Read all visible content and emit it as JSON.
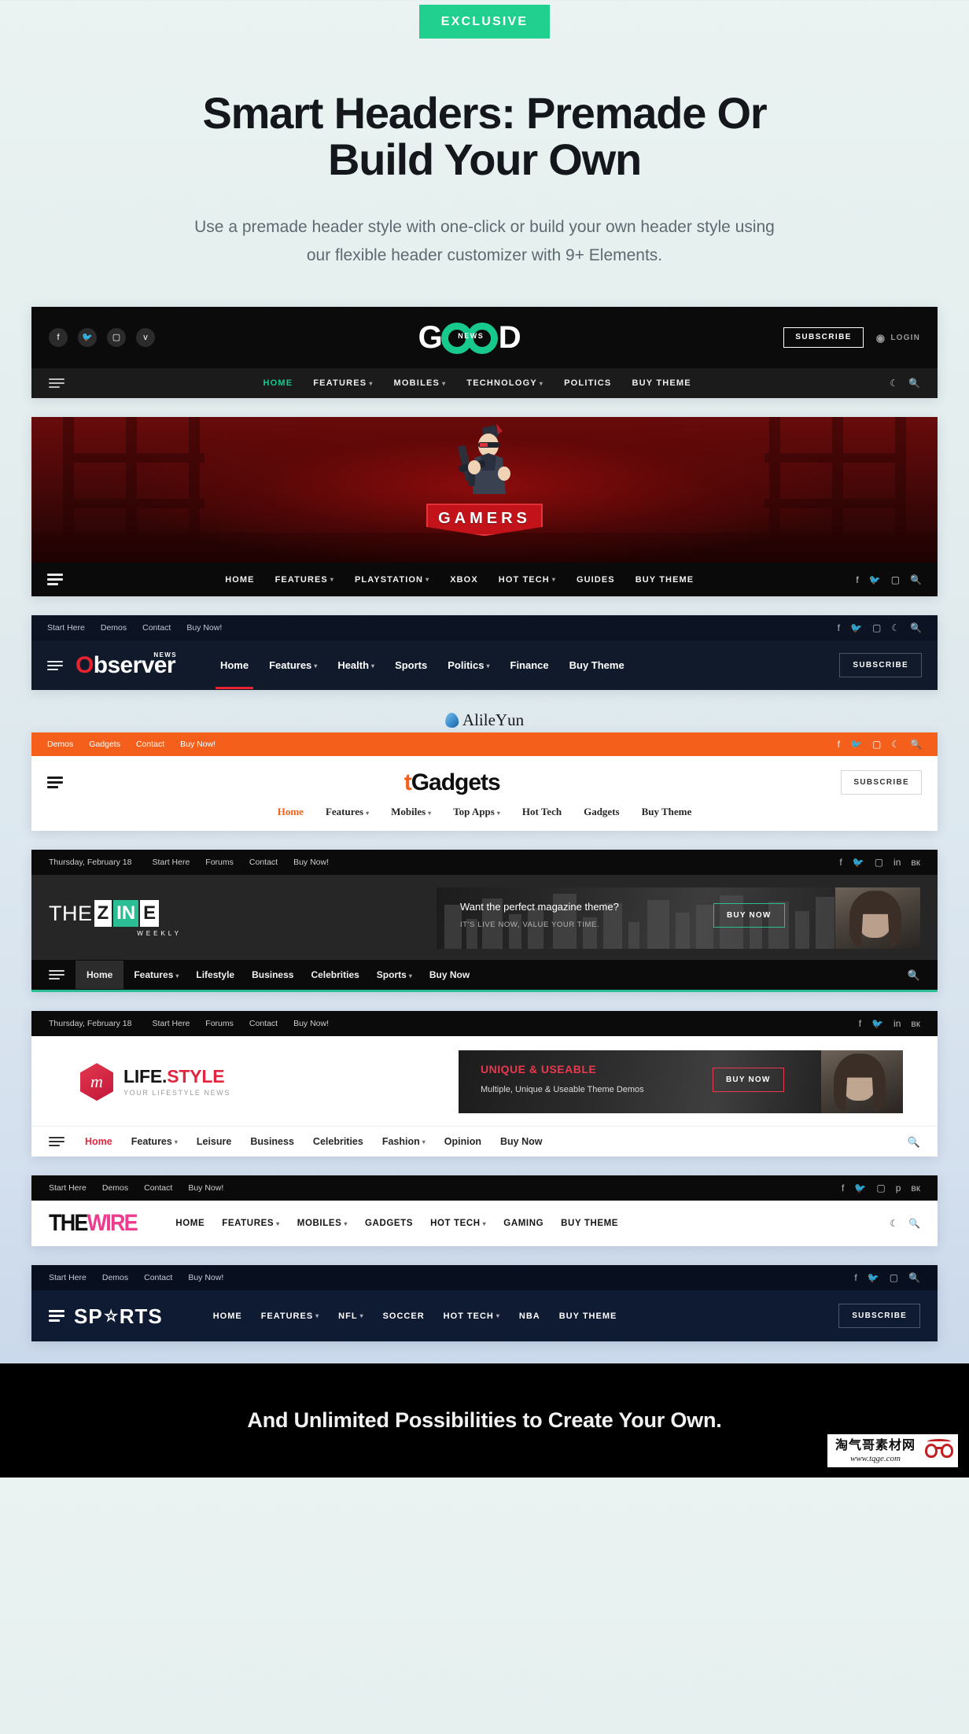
{
  "hero": {
    "badge": "EXCLUSIVE",
    "title_line1": "Smart Headers: Premade Or",
    "title_line2": "Build Your Own",
    "subtitle": "Use a premade header style with one-click or build your own header style using our flexible header customizer with 9+ Elements.",
    "accent_color": "#21d08f"
  },
  "headers": {
    "good": {
      "name": "GOOD NEWS",
      "logo_g": "G",
      "logo_d": "D",
      "logo_badge": "NEWS",
      "social": [
        "facebook-icon",
        "twitter-icon",
        "instagram-icon",
        "vimeo-icon"
      ],
      "subscribe": "SUBSCRIBE",
      "login": "LOGIN",
      "nav": [
        {
          "label": "HOME",
          "active": true,
          "caret": false
        },
        {
          "label": "FEATURES",
          "active": false,
          "caret": true
        },
        {
          "label": "MOBILES",
          "active": false,
          "caret": true
        },
        {
          "label": "TECHNOLOGY",
          "active": false,
          "caret": true
        },
        {
          "label": "POLITICS",
          "active": false,
          "caret": false
        },
        {
          "label": "BUY THEME",
          "active": false,
          "caret": false
        }
      ],
      "accent": "#17c98c"
    },
    "gamers": {
      "name": "GAMERS",
      "logo_text": "GAMERS",
      "nav": [
        {
          "label": "HOME",
          "caret": false
        },
        {
          "label": "FEATURES",
          "caret": true
        },
        {
          "label": "PLAYSTATION",
          "caret": true
        },
        {
          "label": "XBOX",
          "caret": false
        },
        {
          "label": "HOT TECH",
          "caret": true
        },
        {
          "label": "GUIDES",
          "caret": false
        },
        {
          "label": "BUY THEME",
          "caret": false
        }
      ],
      "social": [
        "facebook-icon",
        "twitter-icon",
        "instagram-icon"
      ],
      "accent": "#c2131a"
    },
    "observer": {
      "name": "Observer",
      "logo_o": "O",
      "logo_rest": "bserver",
      "logo_sup": "NEWS",
      "topbar": [
        "Start Here",
        "Demos",
        "Contact",
        "Buy Now!"
      ],
      "social": [
        "facebook-icon",
        "twitter-icon",
        "instagram-icon",
        "moon-icon",
        "search-icon"
      ],
      "subscribe": "SUBSCRIBE",
      "nav": [
        {
          "label": "Home",
          "active": true,
          "caret": false
        },
        {
          "label": "Features",
          "active": false,
          "caret": true
        },
        {
          "label": "Health",
          "active": false,
          "caret": true
        },
        {
          "label": "Sports",
          "active": false,
          "caret": false
        },
        {
          "label": "Politics",
          "active": false,
          "caret": true
        },
        {
          "label": "Finance",
          "active": false,
          "caret": false
        },
        {
          "label": "Buy Theme",
          "active": false,
          "caret": false
        }
      ],
      "accent": "#e8232f"
    },
    "watermark_top": {
      "text_a": "Alile",
      "text_y": "Y",
      "text_b": "un"
    },
    "gadgets": {
      "name": "Gadgets",
      "logo_t": "t",
      "logo_rest": "Gadgets",
      "topbar": [
        "Demos",
        "Gadgets",
        "Contact",
        "Buy Now!"
      ],
      "social": [
        "facebook-icon",
        "twitter-icon",
        "instagram-icon",
        "moon-icon",
        "search-icon"
      ],
      "subscribe": "SUBSCRIBE",
      "nav": [
        {
          "label": "Home",
          "active": true,
          "caret": false
        },
        {
          "label": "Features",
          "active": false,
          "caret": true
        },
        {
          "label": "Mobiles",
          "active": false,
          "caret": true
        },
        {
          "label": "Top Apps",
          "active": false,
          "caret": true
        },
        {
          "label": "Hot Tech",
          "active": false,
          "caret": false
        },
        {
          "label": "Gadgets",
          "active": false,
          "caret": false
        },
        {
          "label": "Buy Theme",
          "active": false,
          "caret": false
        }
      ],
      "accent": "#f4601c"
    },
    "zine": {
      "name": "THE ZINE WEEKLY",
      "logo_the": "THE",
      "logo_z": "Z",
      "logo_in": "IN",
      "logo_e": "E",
      "logo_weekly": "WEEKLY",
      "date": "Thursday, February 18",
      "topbar": [
        "Start Here",
        "Forums",
        "Contact",
        "Buy Now!"
      ],
      "social": [
        "facebook-icon",
        "twitter-icon",
        "instagram-icon",
        "linkedin-icon",
        "vk-icon"
      ],
      "banner": {
        "title": "Want the perfect magazine theme?",
        "subtitle": "IT'S LIVE NOW, VALUE YOUR TIME.",
        "button": "BUY NOW"
      },
      "nav": [
        {
          "label": "Home",
          "active": true,
          "caret": false
        },
        {
          "label": "Features",
          "active": false,
          "caret": true
        },
        {
          "label": "Lifestyle",
          "active": false,
          "caret": false
        },
        {
          "label": "Business",
          "active": false,
          "caret": false
        },
        {
          "label": "Celebrities",
          "active": false,
          "caret": false
        },
        {
          "label": "Sports",
          "active": false,
          "caret": true
        },
        {
          "label": "Buy Now",
          "active": false,
          "caret": false
        }
      ],
      "accent": "#2bbd94"
    },
    "lifestyle": {
      "name": "LIFE.STYLE",
      "logo_mark": "m",
      "logo_a": "LIFE.",
      "logo_b": "STYLE",
      "tagline": "YOUR LIFESTYLE NEWS",
      "date": "Thursday, February 18",
      "topbar": [
        "Start Here",
        "Forums",
        "Contact",
        "Buy Now!"
      ],
      "social": [
        "facebook-icon",
        "twitter-icon",
        "linkedin-icon",
        "vk-icon"
      ],
      "banner": {
        "title": "UNIQUE & USEABLE",
        "subtitle": "Multiple, Unique & Useable Theme Demos",
        "button": "BUY NOW"
      },
      "nav": [
        {
          "label": "Home",
          "active": true,
          "caret": false
        },
        {
          "label": "Features",
          "active": false,
          "caret": true
        },
        {
          "label": "Leisure",
          "active": false,
          "caret": false
        },
        {
          "label": "Business",
          "active": false,
          "caret": false
        },
        {
          "label": "Celebrities",
          "active": false,
          "caret": false
        },
        {
          "label": "Fashion",
          "active": false,
          "caret": true
        },
        {
          "label": "Opinion",
          "active": false,
          "caret": false
        },
        {
          "label": "Buy Now",
          "active": false,
          "caret": false
        }
      ],
      "accent": "#e0273f"
    },
    "wire": {
      "name": "THE WIRE",
      "logo_the": "THE",
      "logo_wire": "WIRE",
      "topbar": [
        "Start Here",
        "Demos",
        "Contact",
        "Buy Now!"
      ],
      "social": [
        "facebook-icon",
        "twitter-icon",
        "instagram-icon",
        "pinterest-icon",
        "vk-icon"
      ],
      "nav": [
        {
          "label": "HOME",
          "caret": false
        },
        {
          "label": "FEATURES",
          "caret": true
        },
        {
          "label": "MOBILES",
          "caret": true
        },
        {
          "label": "GADGETS",
          "caret": false
        },
        {
          "label": "HOT TECH",
          "caret": true
        },
        {
          "label": "GAMING",
          "caret": false
        },
        {
          "label": "BUY THEME",
          "caret": false
        }
      ],
      "right_icons": [
        "moon-icon",
        "search-icon"
      ],
      "accent": "#ec3d8e"
    },
    "sports": {
      "name": "SPORTS",
      "logo_a": "SP",
      "logo_b": "RTS",
      "topbar": [
        "Start Here",
        "Demos",
        "Contact",
        "Buy Now!"
      ],
      "social": [
        "facebook-icon",
        "twitter-icon",
        "instagram-icon",
        "search-icon"
      ],
      "subscribe": "SUBSCRIBE",
      "nav": [
        {
          "label": "HOME",
          "caret": false
        },
        {
          "label": "FEATURES",
          "caret": true
        },
        {
          "label": "NFL",
          "caret": true
        },
        {
          "label": "SOCCER",
          "caret": false
        },
        {
          "label": "HOT TECH",
          "caret": true
        },
        {
          "label": "NBA",
          "caret": false
        },
        {
          "label": "BUY THEME",
          "caret": false
        }
      ],
      "accent": "#0f1a33"
    }
  },
  "footer": {
    "headline": "And Unlimited Possibilities to Create Your Own.",
    "stamp_cn": "淘气哥素材网",
    "stamp_url": "www.tqge.com"
  }
}
